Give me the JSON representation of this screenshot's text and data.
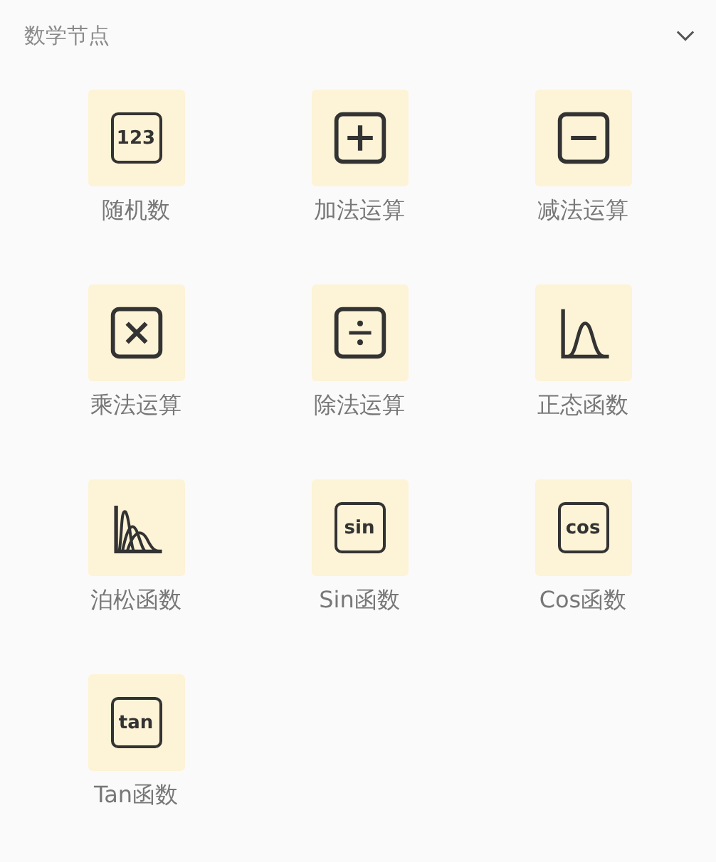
{
  "section": {
    "title": "数学节点",
    "expanded": true
  },
  "nodes": [
    {
      "kind": "text",
      "glyph": "123",
      "label": "随机数"
    },
    {
      "kind": "plus",
      "label": "加法运算"
    },
    {
      "kind": "minus",
      "label": "减法运算"
    },
    {
      "kind": "times",
      "label": "乘法运算"
    },
    {
      "kind": "divide",
      "label": "除法运算"
    },
    {
      "kind": "normal",
      "label": "正态函数"
    },
    {
      "kind": "poisson",
      "label": "泊松函数"
    },
    {
      "kind": "text",
      "glyph": "sin",
      "label": "Sin函数"
    },
    {
      "kind": "text",
      "glyph": "cos",
      "label": "Cos函数"
    },
    {
      "kind": "text",
      "glyph": "tan",
      "label": "Tan函数"
    }
  ]
}
